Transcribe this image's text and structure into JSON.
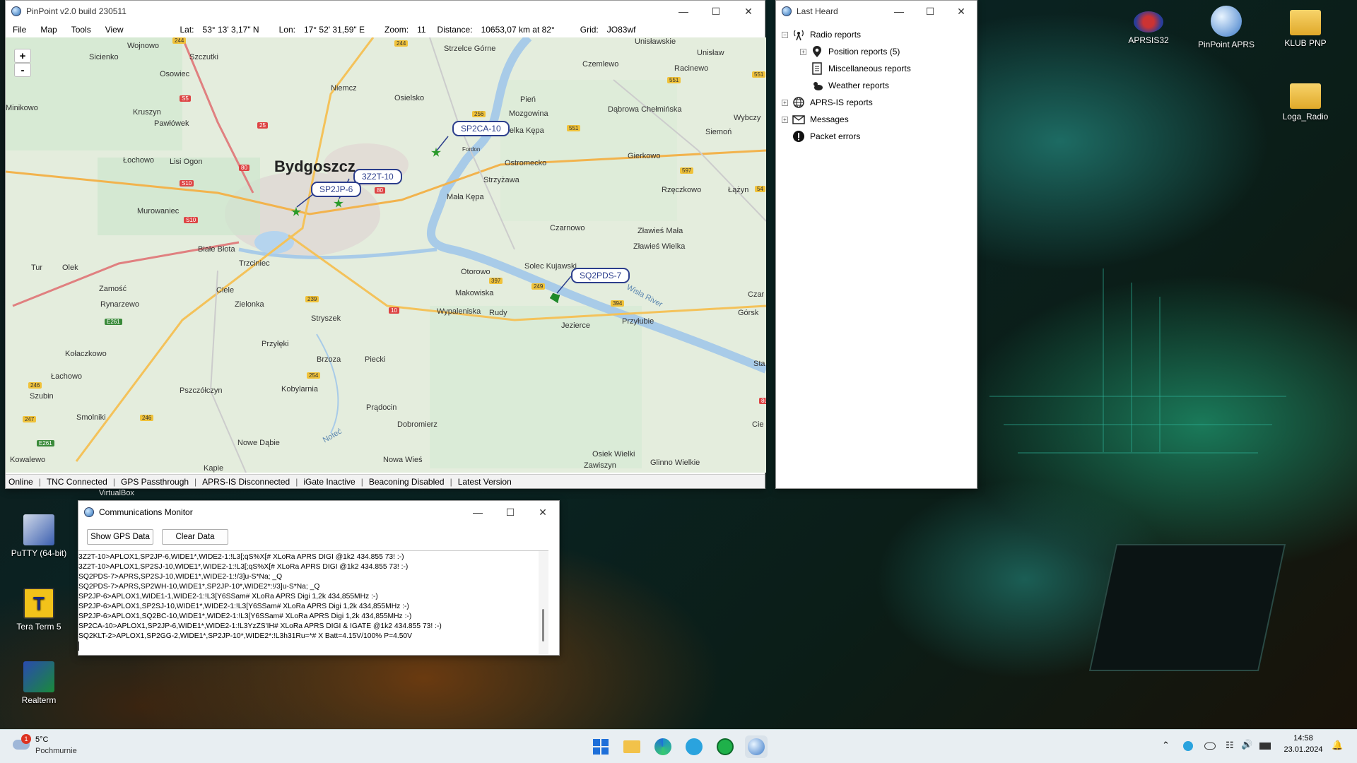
{
  "pinpoint": {
    "title": "PinPoint v2.0 build 230511",
    "menu": [
      "File",
      "Map",
      "Tools",
      "View"
    ],
    "lat_label": "Lat:",
    "lat": "53° 13' 3,17\" N",
    "lon_label": "Lon:",
    "lon": "17° 52' 31,59\" E",
    "zoom_label": "Zoom:",
    "zoom": "11",
    "distance_label": "Distance:",
    "distance": "10653,07 km at 82°",
    "grid_label": "Grid:",
    "grid": "JO83wf",
    "zoom_in": "+",
    "zoom_out": "-",
    "status": [
      "Online",
      "TNC Connected",
      "GPS Passthrough",
      "APRS-IS Disconnected",
      "iGate Inactive",
      "Beaconing Disabled",
      "Latest Version"
    ],
    "stations": [
      "SP2CA-10",
      "3Z2T-10",
      "SP2JP-6",
      "SQ2PDS-7"
    ],
    "places": [
      "Bydgoszcz",
      "Wojnowo",
      "Szczutki",
      "Sicienko",
      "Osowiec",
      "Minikowo",
      "Kruszyn",
      "Pawłówek",
      "Łochowo",
      "Lisi Ogon",
      "Murowaniec",
      "Białe Błota",
      "Trzciniec",
      "Tur",
      "Olek",
      "Zamość",
      "Rynarzewo",
      "Ciele",
      "Zielonka",
      "Stryszek",
      "Przyłęki",
      "Kołaczkowo",
      "Łachowo",
      "Szubin",
      "Pszczółczyn",
      "Brzoza",
      "Kobylarnia",
      "Piecki",
      "Prądocin",
      "Smolniki",
      "Dobromierz",
      "Nowe Dąbie",
      "Nowa Wieś",
      "Kowalewo",
      "Kapie",
      "Niemcz",
      "Osielsko",
      "Strzelce Górne",
      "Czemlewo",
      "Unisławskie",
      "Unisław",
      "Racinewo",
      "Pień",
      "Mozgowina",
      "Dąbrowa Chełmińska",
      "Wybczy",
      "Siemoń",
      "Fordon",
      "Ostromecko",
      "Gierkowo",
      "Strzyżawa",
      "Rzęczkowo",
      "Łążyn",
      "Mała Kępa",
      "Czarnowo",
      "Zławieś Mała",
      "Zławieś Wielka",
      "Otorowo",
      "Solec Kujawski",
      "Makowiska",
      "Wypaleniska",
      "Rudy",
      "Jezierce",
      "Przyłubie",
      "Górsk",
      "Czar",
      "Osiek Wielki",
      "Zawiszyn",
      "Glinno Wielkie",
      "Wisła River",
      "Noteć",
      "Sta",
      "Cie",
      "Wielka Kępa"
    ],
    "roads": [
      "244",
      "244",
      "S5",
      "25",
      "80",
      "S10",
      "S10",
      "80",
      "E261",
      "239",
      "10",
      "397",
      "249",
      "394",
      "254",
      "246",
      "247",
      "246",
      "E261",
      "551",
      "256",
      "551",
      "597",
      "551",
      "54",
      "80"
    ]
  },
  "lastheard": {
    "title": "Last Heard",
    "items": [
      {
        "label": "Radio reports",
        "icon": "antenna-icon"
      },
      {
        "label": "Position reports (5)",
        "icon": "map-pin-icon"
      },
      {
        "label": "Miscellaneous reports",
        "icon": "document-icon"
      },
      {
        "label": "Weather reports",
        "icon": "cloud-sun-icon"
      },
      {
        "label": "APRS-IS reports",
        "icon": "globe-icon"
      },
      {
        "label": "Messages",
        "icon": "envelope-icon"
      },
      {
        "label": "Packet errors",
        "icon": "error-icon"
      }
    ]
  },
  "commmon": {
    "title": "Communications Monitor",
    "show_gps": "Show GPS Data",
    "clear": "Clear Data",
    "lines": [
      "3Z2T-10>APLOX1,SP2JP-6,WIDE1*,WIDE2-1:!L3[;qS%X[#  XLoRa APRS DIGI @1k2 434.855  73! :-)",
      "3Z2T-10>APLOX1,SP2SJ-10,WIDE1*,WIDE2-1:!L3[;qS%X[#  XLoRa APRS DIGI @1k2 434.855  73! :-)",
      "SQ2PDS-7>APRS,SP2SJ-10,WIDE1*,WIDE2-1:!/3]u-S*Na; _Q",
      "SQ2PDS-7>APRS,SP2WH-10,WIDE1*,SP2JP-10*,WIDE2*:!/3]u-S*Na; _Q",
      "SP2JP-6>APLOX1,WIDE1-1,WIDE2-1:!L3[Y6SSam#  XLoRa APRS Digi 1,2k 434,855MHz :-)",
      "SP2JP-6>APLOX1,SP2SJ-10,WIDE1*,WIDE2-1:!L3[Y6SSam#  XLoRa APRS Digi 1,2k 434,855MHz :-)",
      "SP2JP-6>APLOX1,SQ2BC-10,WIDE1*,WIDE2-1:!L3[Y6SSam#  XLoRa APRS Digi 1,2k 434,855MHz :-)",
      "SP2CA-10>APLOX1,SP2JP-6,WIDE1*,WIDE2-1:!L3YzZS'IH#  XLoRa APRS DIGI & IGATE @1k2 434.855  73! :-)",
      "SQ2KLT-2>APLOX1,SP2GG-2,WIDE1*,SP2JP-10*,WIDE2*:!L3h31Ru=*#  X Batt=4.15V/100% P=4.50V"
    ]
  },
  "desktop": {
    "icons": [
      "APRSIS32",
      "PinPoint APRS",
      "KLUB PNP",
      "Loga_Radio",
      "PuTTY (64-bit)",
      "Tera Term 5",
      "Realterm"
    ],
    "virtualbox_label": "VirtualBox"
  },
  "taskbar": {
    "weather_temp": "5°C",
    "weather_desc": "Pochmurnie",
    "weather_badge": "1",
    "time": "14:58",
    "date": "23.01.2024"
  }
}
